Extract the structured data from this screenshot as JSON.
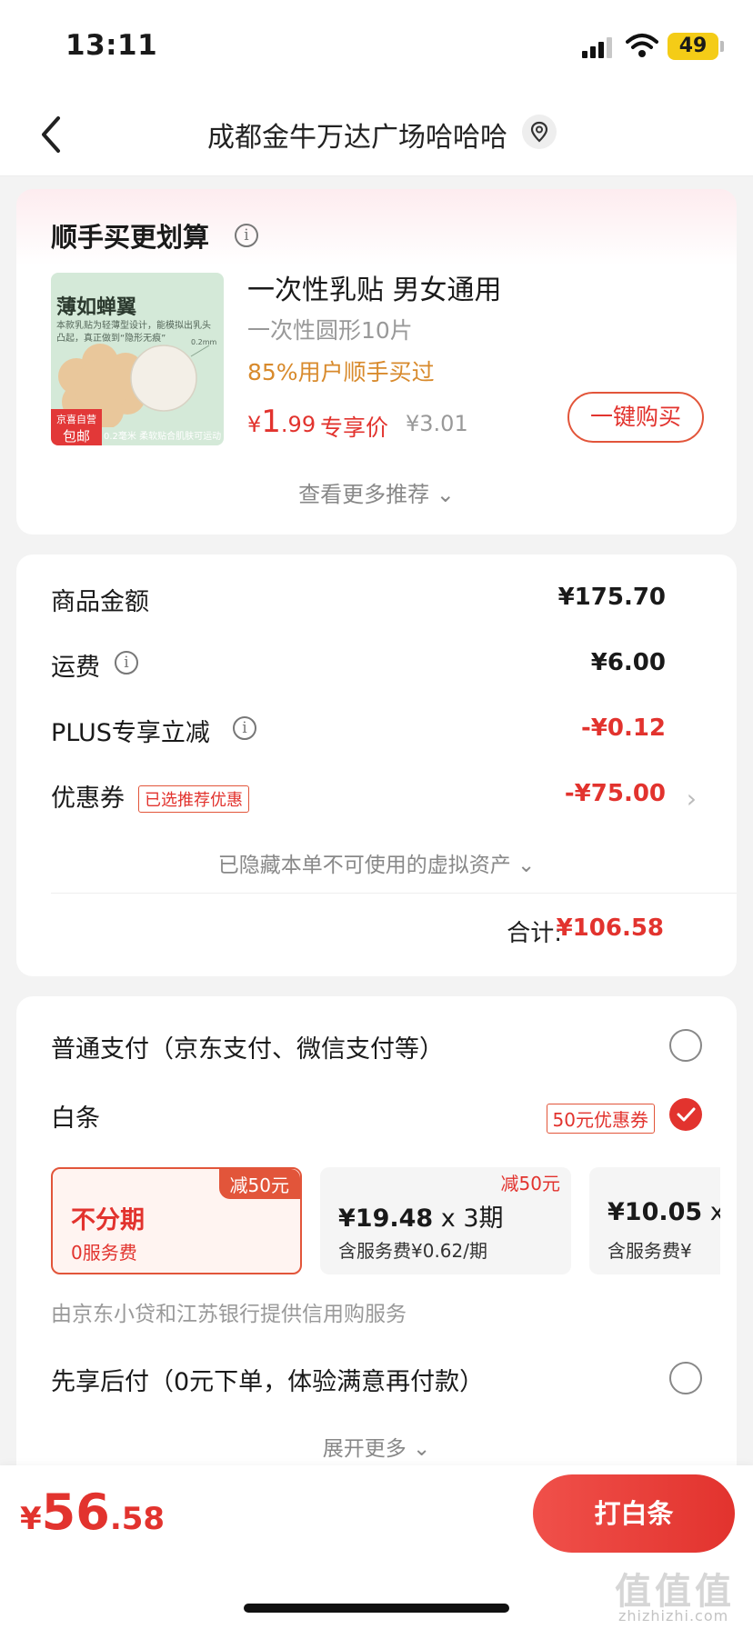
{
  "status_bar": {
    "time": "13:11",
    "battery": "49"
  },
  "nav": {
    "title": "成都金牛万达广场哈哈哈"
  },
  "recommend": {
    "section_title": "顺手买更划算",
    "info": "i",
    "product": {
      "image_title": "薄如蝉翼",
      "image_subtitle": "本款乳贴为轻薄型设计，能模拟出乳头凸起，真正做到“隐形无痕”",
      "image_badge_line1": "京喜自营",
      "image_badge_line2": "包邮",
      "image_footer": "0.2毫米 柔软贴合肌肤可运动",
      "name": "一次性乳贴 男女通用",
      "spec": "一次性圆形10片",
      "social_proof": "85%用户顺手买过",
      "price_currency": "¥",
      "price_int": "1",
      "price_dec": ".99",
      "price_tag": "专享价",
      "original_price": "¥3.01",
      "buy_button": "一键购买"
    },
    "more": "查看更多推荐 ⌄"
  },
  "summary": {
    "rows": [
      {
        "label": "商品金额",
        "value": "¥175.70"
      },
      {
        "label": "运费",
        "value": "¥6.00"
      },
      {
        "label": "PLUS专享立减",
        "value": "-¥0.12"
      },
      {
        "label": "优惠券",
        "tag": "已选推荐优惠",
        "value": "-¥75.00"
      }
    ],
    "hidden_assets": "已隐藏本单不可使用的虚拟资产 ⌄",
    "total_label": "合计:",
    "total_value": "¥106.58"
  },
  "payment": {
    "normal": "普通支付（京东支付、微信支付等）",
    "baitiao": "白条",
    "baitiao_coupon": "50元优惠券",
    "plans": [
      {
        "badge": "减50元",
        "main": "不分期",
        "times": "",
        "sub": "0服务费"
      },
      {
        "badge": "减50元",
        "main": "¥19.48",
        "times": " x 3期",
        "sub": "含服务费¥0.62/期"
      },
      {
        "badge": "",
        "main": "¥10.05",
        "times": " x",
        "sub": "含服务费¥"
      }
    ],
    "credit_note": "由京东小贷和江苏银行提供信用购服务",
    "later": "先享后付（0元下单，体验满意再付款）",
    "expand": "展开更多 ⌄"
  },
  "footer": {
    "price_currency": "¥",
    "price_int": "56",
    "price_dec": ".58",
    "pay_button": "打白条",
    "watermark": "值值值",
    "watermark_url": "zhizhizhi.com"
  },
  "colors": {
    "accent": "#e2332e",
    "social": "#d88a2c",
    "battery": "#f4cc17"
  }
}
